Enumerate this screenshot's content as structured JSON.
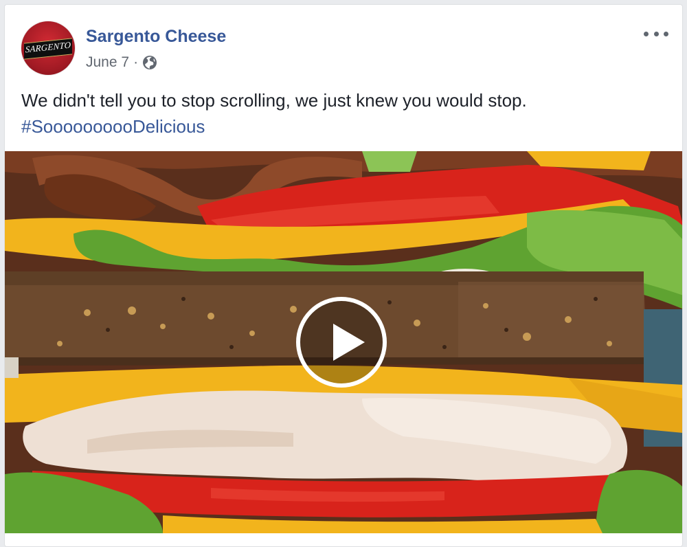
{
  "post": {
    "page_name": "Sargento Cheese",
    "avatar_logo_text": "SARGENTO",
    "date": "June 7",
    "separator": "·",
    "privacy_icon": "globe-icon",
    "more_icon": "more-options-icon",
    "message": "We didn't tell you to stop scrolling, we just knew you would stop.",
    "hashtag": "#SoooooooooDelicious",
    "video": {
      "subject": "sandwich-close-up",
      "play_icon": "play-icon"
    }
  },
  "colors": {
    "link": "#385898",
    "text": "#1d2129",
    "meta": "#616770",
    "brand_red": "#b81f28"
  }
}
